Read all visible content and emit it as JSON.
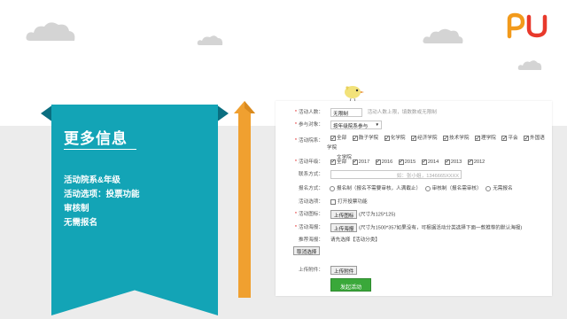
{
  "slide": {
    "heading": "更多信息",
    "lines": [
      "活动院系&年级",
      "活动选项：投票功能",
      "审核制",
      "无需报名"
    ]
  },
  "brand": {
    "logo_text": "PU",
    "colors": {
      "teal": "#13a4b6",
      "orange": "#f0a030",
      "logo_orange": "#f29a1b",
      "logo_red": "#e8392b",
      "green": "#3aa83a"
    }
  },
  "form": {
    "count": {
      "label": "活动人数：",
      "value": "无限制",
      "hint": "活动人数上限，填数数或无限制"
    },
    "audience": {
      "label": "参与对象：",
      "selected": "按年级院系参与"
    },
    "faculty": {
      "label": "活动院系：",
      "options": [
        "全部",
        "鼓子学院",
        "化学院",
        "经济学院",
        "技术学院",
        "理学院",
        "平会",
        "外国语学院",
        "文学院"
      ]
    },
    "grade": {
      "label": "活动年级：",
      "options": [
        "全部",
        "2017",
        "2016",
        "2015",
        "2014",
        "2013",
        "2012"
      ]
    },
    "contact": {
      "label": "联系方式：",
      "placeholder": "如：张小姐，1346665XXXX"
    },
    "mode": {
      "label": "报名方式：",
      "options": [
        "报名制（报名不需要审核，人满截止）",
        "审核制（报名需审核）",
        "无需报名"
      ]
    },
    "options": {
      "label": "活动选项：",
      "vote": "打开投票功能"
    },
    "icon": {
      "label": "活动图标：",
      "button": "上传图标",
      "hint": "(尺寸为125*125)"
    },
    "poster": {
      "label": "活动海报：",
      "button": "上传海报",
      "hint": "(尺寸为1500*357如果没有，可根据活动分类选择下面一款推荐的默认海报)"
    },
    "recommend": {
      "label": "推荐海报：",
      "text": "请先选择【活动分类】"
    },
    "cancel_button": "取消选择",
    "attachment": {
      "label": "上传附件：",
      "button": "上传附件"
    },
    "submit_button": "发起活动"
  }
}
